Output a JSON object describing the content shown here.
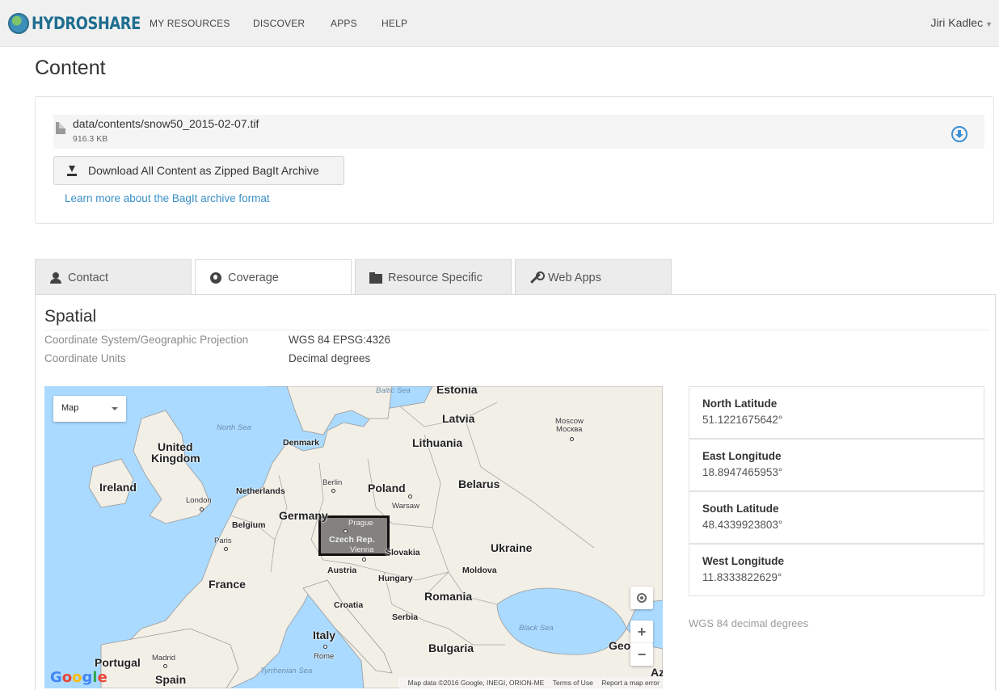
{
  "nav": {
    "logo_text": "HYDROSHARE",
    "items": [
      "MY RESOURCES",
      "DISCOVER",
      "APPS",
      "HELP"
    ],
    "user": "Jiri Kadlec"
  },
  "page_title": "Content",
  "content": {
    "file_name": "data/contents/snow50_2015-02-07.tif",
    "file_size": "916.3 KB",
    "download_all_label": "Download All Content as Zipped BagIt Archive",
    "bagit_link": "Learn more about the BagIt archive format"
  },
  "tabs": [
    "Contact",
    "Coverage",
    "Resource Specific",
    "Web Apps"
  ],
  "active_tab": "Coverage",
  "spatial": {
    "title": "Spatial",
    "coord_system_label": "Coordinate System/Geographic Projection",
    "coord_system_value": "WGS 84 EPSG:4326",
    "units_label": "Coordinate Units",
    "units_value": "Decimal degrees",
    "north_label": "North Latitude",
    "north_value": "51.1221675642°",
    "east_label": "East Longitude",
    "east_value": "18.8947465953°",
    "south_label": "South Latitude",
    "south_value": "48.4339923803°",
    "west_label": "West Longitude",
    "west_value": "11.8333822629°",
    "units_note": "WGS 84 decimal degrees"
  },
  "map": {
    "type_select": "Map",
    "zoom_in": "+",
    "zoom_out": "−",
    "attribution": "Map data ©2016 Google, INEGI, ORION-ME",
    "terms": "Terms of Use",
    "report": "Report a map error",
    "google_logo": [
      "G",
      "o",
      "o",
      "g",
      "l",
      "e"
    ],
    "labels": {
      "baltic_sea": "Baltic Sea",
      "estonia": "Estonia",
      "latvia": "Latvia",
      "moscow": "Moscow",
      "moscow_ru": "Москва",
      "north_sea": "North Sea",
      "denmark": "Denmark",
      "lithuania": "Lithuania",
      "uk_1": "United",
      "uk_2": "Kingdom",
      "ireland": "Ireland",
      "london": "London",
      "netherlands": "Netherlands",
      "berlin": "Berlin",
      "poland": "Poland",
      "warsaw": "Warsaw",
      "belarus": "Belarus",
      "belgium": "Belgium",
      "germany": "Germany",
      "prague": "Prague",
      "czech": "Czech Rep.",
      "vienna": "Vienna",
      "slovakia": "Slovakia",
      "paris": "Paris",
      "ukraine": "Ukraine",
      "austria": "Austria",
      "hungary": "Hungary",
      "moldova": "Moldova",
      "france": "France",
      "romania": "Romania",
      "croatia": "Croatia",
      "serbia": "Serbia",
      "black_sea": "Black Sea",
      "italy": "Italy",
      "rome": "Rome",
      "bulgaria": "Bulgaria",
      "georgia": "Geo",
      "portugal": "Portugal",
      "madrid": "Madrid",
      "spain": "Spain",
      "tyrrhenian": "Tyrrhenian Sea",
      "az": "Az"
    }
  }
}
